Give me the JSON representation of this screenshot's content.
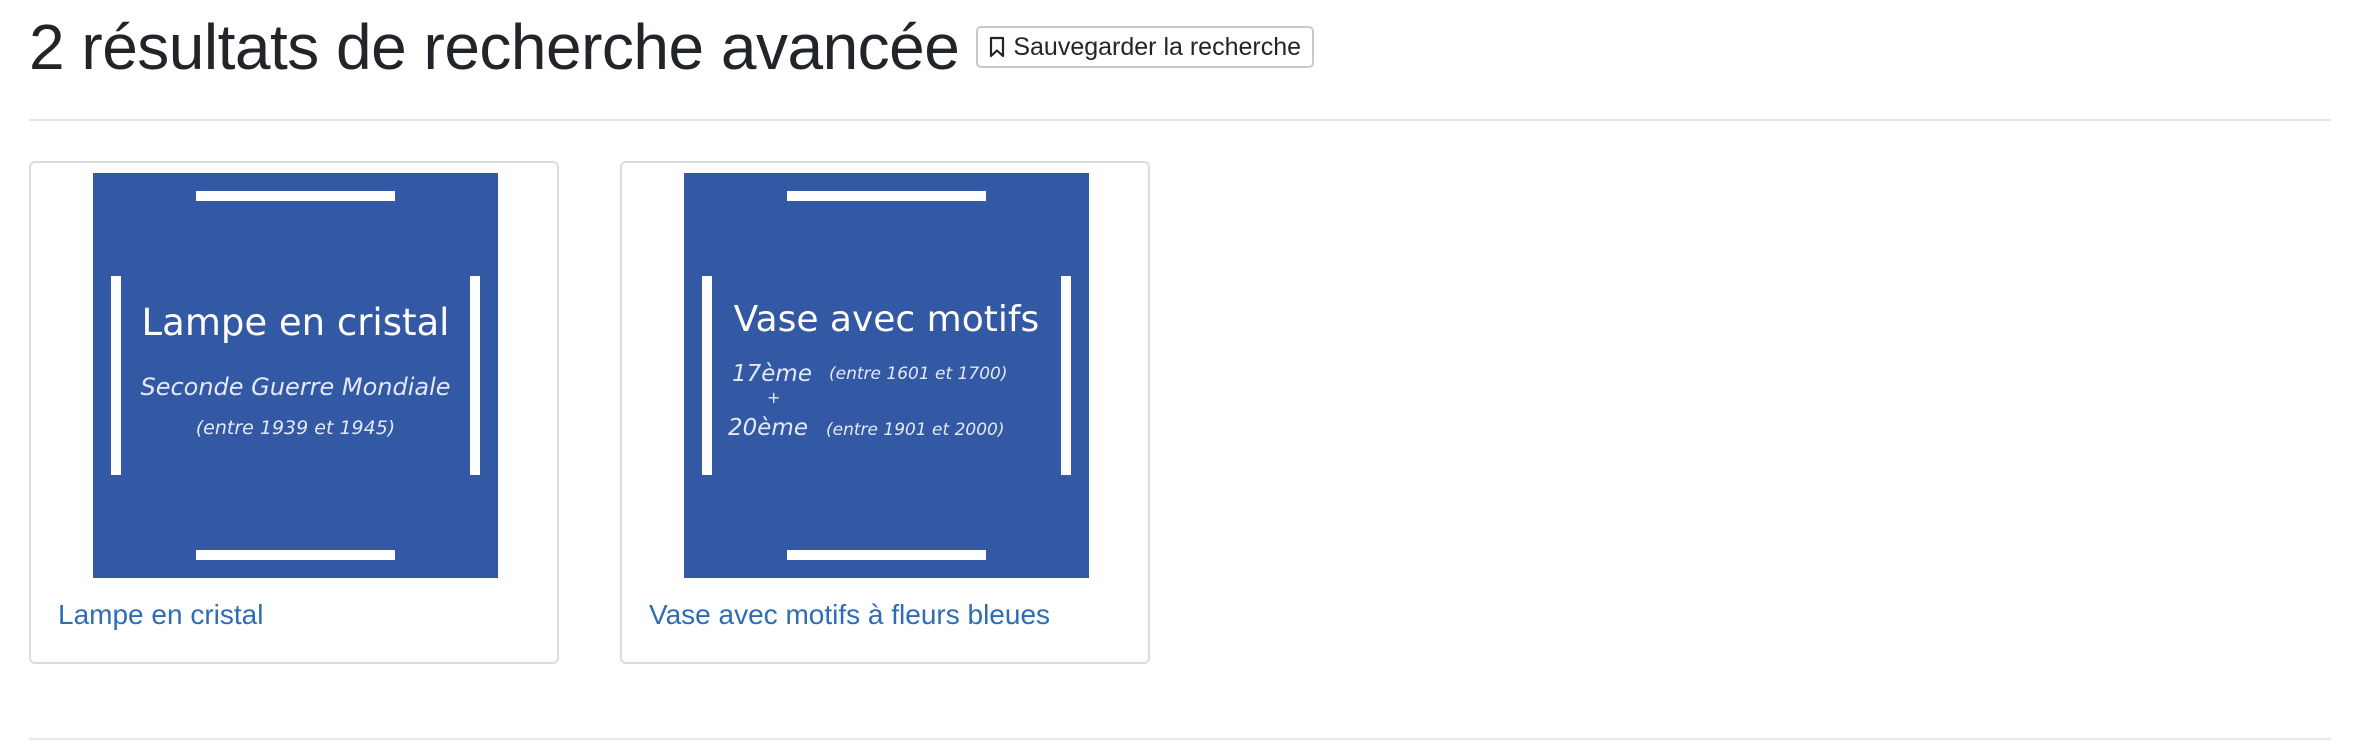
{
  "header": {
    "title": "2 résultats de recherche avancée",
    "save_button": {
      "label": "Sauvegarder la recherche",
      "icon": "bookmark-icon"
    }
  },
  "results": [
    {
      "link_text": "Lampe en cristal",
      "thumbnail": {
        "title": "Lampe en cristal",
        "subtitle": "Seconde Guerre Mondiale",
        "dates": "(entre 1939 et 1945)",
        "background_color": "#3358a4"
      }
    },
    {
      "link_text": "Vase avec motifs à fleurs bleues",
      "thumbnail": {
        "title": "Vase avec motifs",
        "period1": "17ème",
        "period1_dates": "(entre 1601 et 1700)",
        "plus": "+",
        "period2": "20ème",
        "period2_dates": "(entre 1901 et 2000)",
        "background_color": "#3358a4"
      }
    }
  ],
  "colors": {
    "link": "#2e6cb5",
    "divider": "#e7e7e7",
    "card_border": "#dcdcdc",
    "thumbnail_bg": "#3358a4"
  }
}
